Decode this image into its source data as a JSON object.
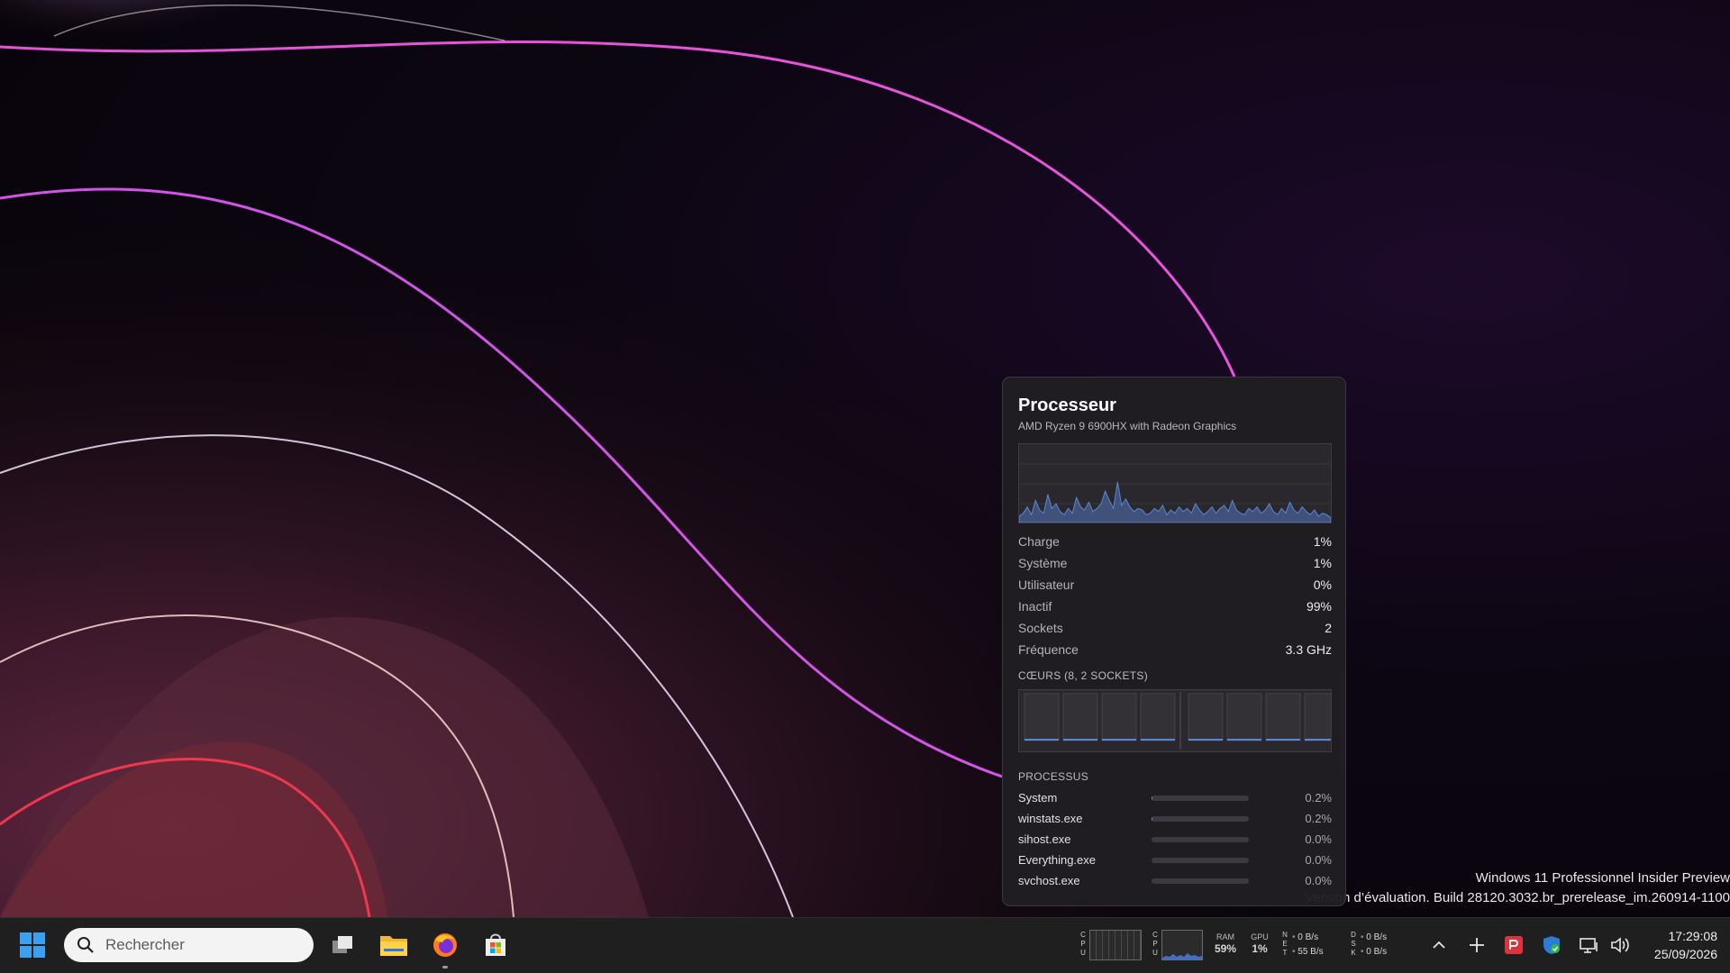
{
  "desktop": {
    "watermark_line1": "Windows 11 Professionnel Insider Preview",
    "watermark_line2": "Version d’évaluation. Build 28120.3032.br_prerelease_im.260914-1100"
  },
  "widget": {
    "title": "Processeur",
    "subtitle": "AMD Ryzen 9 6900HX with Radeon Graphics",
    "graph_color": "#5b86d6",
    "cpu_history_percent": [
      4,
      6,
      10,
      5,
      14,
      8,
      6,
      18,
      9,
      12,
      7,
      5,
      9,
      6,
      16,
      10,
      8,
      13,
      7,
      9,
      12,
      20,
      14,
      9,
      26,
      11,
      15,
      10,
      7,
      9,
      8,
      5,
      6,
      9,
      7,
      11,
      5,
      8,
      6,
      10,
      7,
      9,
      6,
      12,
      8,
      5,
      7,
      10,
      6,
      9,
      11,
      7,
      14,
      8,
      6,
      5,
      9,
      7,
      10,
      6,
      8,
      12,
      7,
      5,
      9,
      6,
      13,
      8,
      6,
      10,
      7,
      5,
      8,
      4,
      6,
      5,
      3
    ],
    "stats": [
      {
        "label": "Charge",
        "value": "1%"
      },
      {
        "label": "Système",
        "value": "1%"
      },
      {
        "label": "Utilisateur",
        "value": "0%"
      },
      {
        "label": "Inactif",
        "value": "99%"
      },
      {
        "label": "Sockets",
        "value": "2"
      },
      {
        "label": "Fréquence",
        "value": "3.3 GHz"
      }
    ],
    "cores_title": "CŒURS (8, 2 SOCKETS)",
    "core_load_percent": [
      2,
      1,
      3,
      1,
      2,
      1,
      1,
      2
    ],
    "processes_title": "PROCESSUS",
    "processes": [
      {
        "name": "System",
        "value": "0.2%",
        "fraction": 0.002
      },
      {
        "name": "winstats.exe",
        "value": "0.2%",
        "fraction": 0.002
      },
      {
        "name": "sihost.exe",
        "value": "0.0%",
        "fraction": 0
      },
      {
        "name": "Everything.exe",
        "value": "0.0%",
        "fraction": 0
      },
      {
        "name": "svchost.exe",
        "value": "0.0%",
        "fraction": 0
      }
    ]
  },
  "taskbar": {
    "search_placeholder": "Rechercher",
    "apps": [
      "windows-start-icon",
      "task-view-icon",
      "file-explorer-icon",
      "firefox-icon",
      "microsoft-store-icon"
    ],
    "cpu_label_letters": [
      "C",
      "P",
      "U"
    ],
    "cpu_label_letters_2": [
      "C",
      "P",
      "U"
    ],
    "ram_label": "RAM",
    "ram_value": "59%",
    "gpu_label": "GPU",
    "gpu_value": "1%",
    "net_letters": [
      "N",
      "E",
      "T"
    ],
    "net_down": "0 B/s",
    "net_up": "55 B/s",
    "disk_letters": [
      "D",
      "S",
      "K"
    ],
    "disk_read": "0 B/s",
    "disk_write": "0 B/s",
    "time": "17:29:08",
    "date": "25/09/2026"
  }
}
